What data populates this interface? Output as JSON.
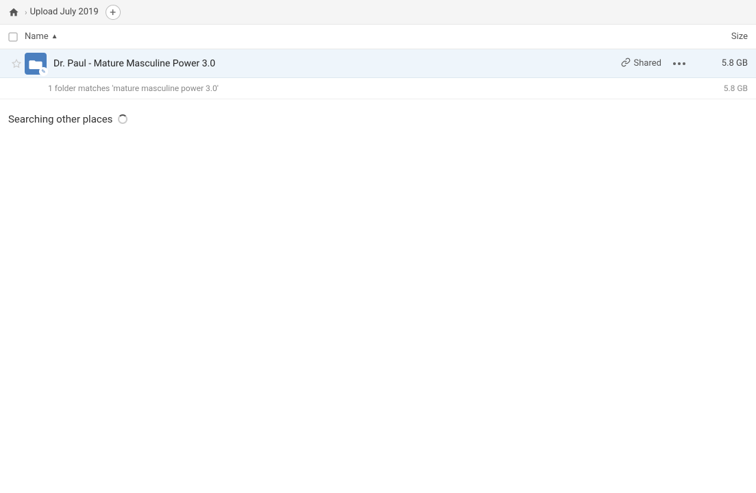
{
  "breadcrumb": {
    "home_label": "Home",
    "title": "Upload July 2019",
    "add_button_label": "+"
  },
  "column_headers": {
    "name_label": "Name",
    "size_label": "Size"
  },
  "file_row": {
    "name": "Dr. Paul - Mature Masculine Power 3.0",
    "shared_label": "Shared",
    "size": "5.8 GB"
  },
  "summary": {
    "text": "1 folder matches 'mature masculine power 3.0'",
    "size": "5.8 GB"
  },
  "searching": {
    "label": "Searching other places"
  },
  "icons": {
    "home": "🏠",
    "star": "☆",
    "link": "🔗",
    "more": "•••"
  }
}
